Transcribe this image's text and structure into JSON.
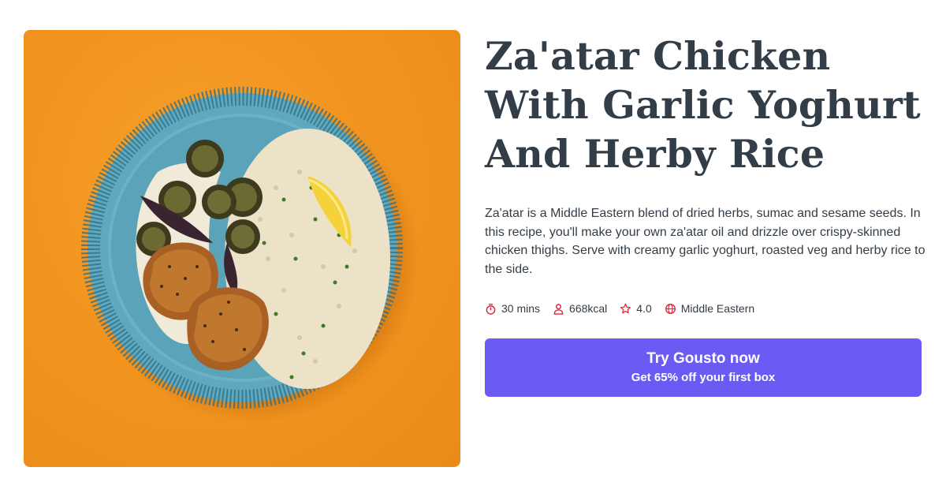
{
  "recipe": {
    "title": "Za'atar Chicken With Garlic Yoghurt And Herby Rice",
    "description": "Za'atar is a Middle Eastern blend of dried herbs, sumac and sesame seeds. In this recipe, you'll make your own za'atar oil and drizzle over crispy-skinned chicken thighs. Serve with creamy garlic yoghurt, roasted veg and herby rice to the side.",
    "meta": {
      "time": "30 mins",
      "calories": "668kcal",
      "rating": "4.0",
      "cuisine": "Middle Eastern"
    },
    "icons": {
      "time": "timer-icon",
      "calories": "person-icon",
      "rating": "star-icon",
      "cuisine": "globe-icon"
    }
  },
  "cta": {
    "title": "Try Gousto now",
    "subtitle": "Get 65% off your first box"
  },
  "colors": {
    "accent": "#6b5bf5",
    "icon": "#e0243d",
    "text": "#333d47",
    "background_orange": "#f29520"
  }
}
